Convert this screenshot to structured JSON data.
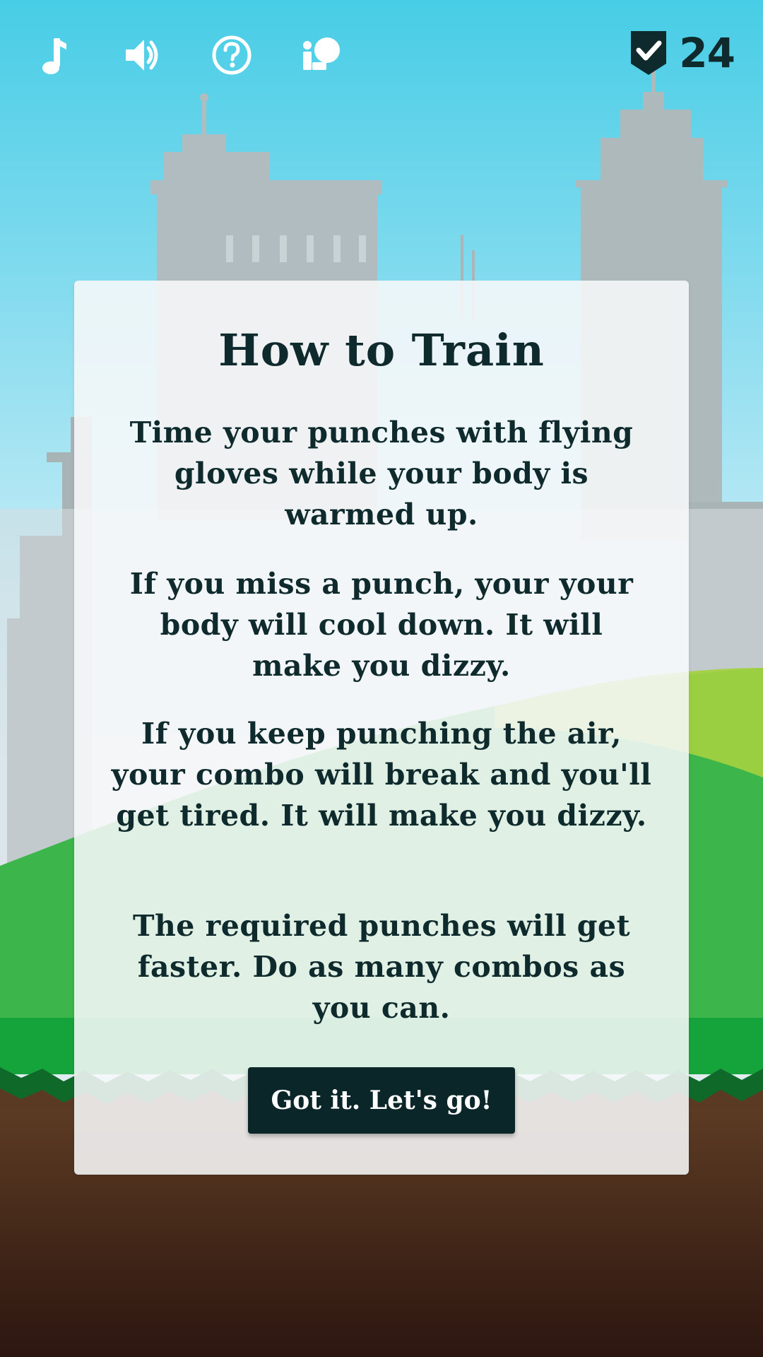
{
  "hud": {
    "icons": [
      "music-note-icon",
      "speaker-icon",
      "help-icon",
      "training-icon"
    ],
    "score": "24"
  },
  "modal": {
    "title": "How to Train",
    "paragraphs": [
      "Time your punches with flying gloves while your body is warmed up.",
      "If you miss a punch, your your body will cool down. It will make you dizzy.",
      "If you keep punching the air, your combo will break and you'll get tired. It will make you dizzy.",
      "The required punches will get faster. Do as many combos as you can."
    ],
    "button_label": "Got it. Let's go!"
  },
  "colors": {
    "text_dark": "#0f2a2c",
    "button_bg": "#0b2628",
    "sky": "#47cde6",
    "grass": "#1fa43a",
    "dirt": "#5b3a22"
  }
}
